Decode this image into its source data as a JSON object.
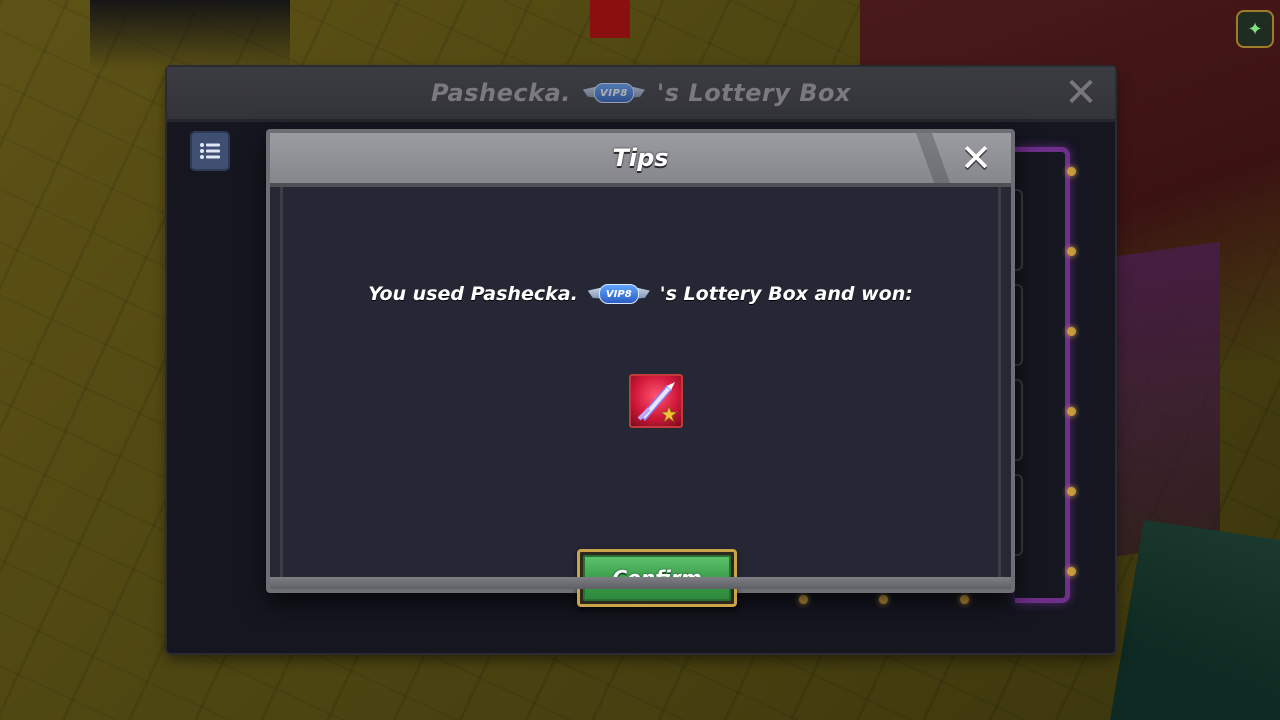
{
  "outer_window": {
    "title_prefix": "Pashecka.",
    "title_suffix": "'s Lottery Box",
    "vip_badge": "VIP8"
  },
  "tips_dialog": {
    "title": "Tips",
    "message_prefix": "You used Pashecka.",
    "message_suffix": "'s Lottery Box and won:",
    "vip_badge": "VIP8",
    "reward_icon": "sword-item-icon",
    "confirm_label": "Confirm"
  },
  "icons": {
    "close": "close-icon",
    "list": "list-icon",
    "corner": "map-icon"
  },
  "colors": {
    "confirm_green": "#3a9b4a",
    "confirm_border": "#caa34a",
    "dialog_bg": "#262836",
    "header_gray": "#8f9096",
    "reward_red": "#d1183a",
    "vip_blue": "#2c5fc2"
  }
}
